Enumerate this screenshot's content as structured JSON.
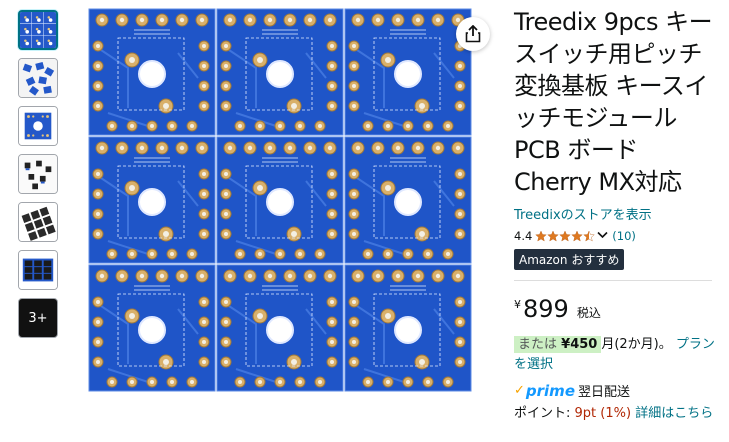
{
  "thumbnails": {
    "more_label": "3+"
  },
  "share": {
    "icon": "share-icon"
  },
  "product": {
    "title": "Treedix 9pcs キースイッチ用ピッチ変換基板 キースイッチモジュール PCB ボード Cherry MX対応",
    "store_link": "Treedixのストアを表示",
    "rating": "4.4",
    "rating_value": 4.4,
    "review_count": "(10)",
    "badge": "Amazon おすすめ"
  },
  "price": {
    "symbol": "¥",
    "amount": "899",
    "tax_label": "税込"
  },
  "installment": {
    "prefix": "または",
    "amount": "¥450",
    "suffix": "月(2か月)。",
    "link": "プランを選択"
  },
  "delivery": {
    "check": "✓",
    "prime_label": "prime",
    "text": "翌日配送"
  },
  "points": {
    "label": "ポイント:",
    "value": "9pt",
    "percent": "(1%)",
    "link": "詳細はこちら"
  },
  "colors": {
    "link": "#007185",
    "pcb_blue": "#1f55c8",
    "prime": "#1399ff",
    "badge_bg": "#232f3e"
  }
}
